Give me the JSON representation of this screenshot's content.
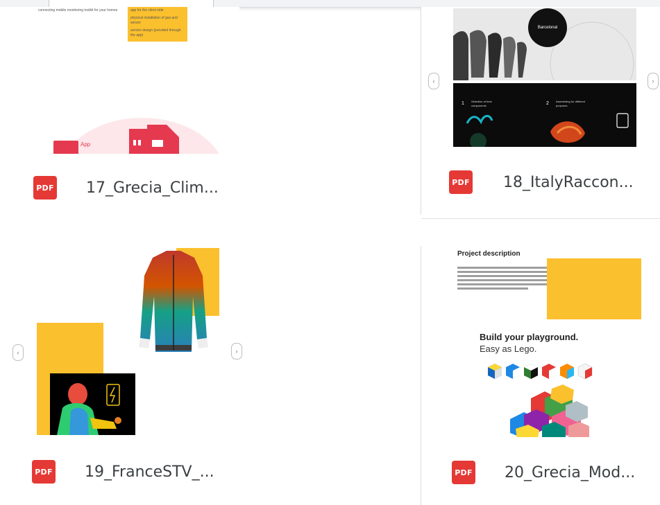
{
  "files": [
    {
      "name": "17_Grecia_Clim...",
      "type_badge": "PDF"
    },
    {
      "name": "18_ItalyRaccon...",
      "type_badge": "PDF"
    },
    {
      "name": "19_FranceSTV_...",
      "type_badge": "PDF"
    },
    {
      "name": "20_Grecia_Mod...",
      "type_badge": "PDF"
    }
  ],
  "thumb17": {
    "bullet1": "connecting mobile monitoring toolkit for your homes",
    "note_top": "app for the client side",
    "note_1": "physical installation of gas and sensor",
    "note_2": "service design (provided through the app)",
    "app_label": "App"
  },
  "thumb18": {
    "circle_label": "Barcelonal",
    "step1": "Selection of best components",
    "step2": "Assembling for different purposes"
  },
  "thumb20": {
    "heading": "Project description",
    "tagline1": "Build your playground.",
    "tagline2": "Easy as Lego."
  },
  "colors": {
    "pdf_red": "#e53935",
    "accent_yellow": "#fbc02d"
  }
}
